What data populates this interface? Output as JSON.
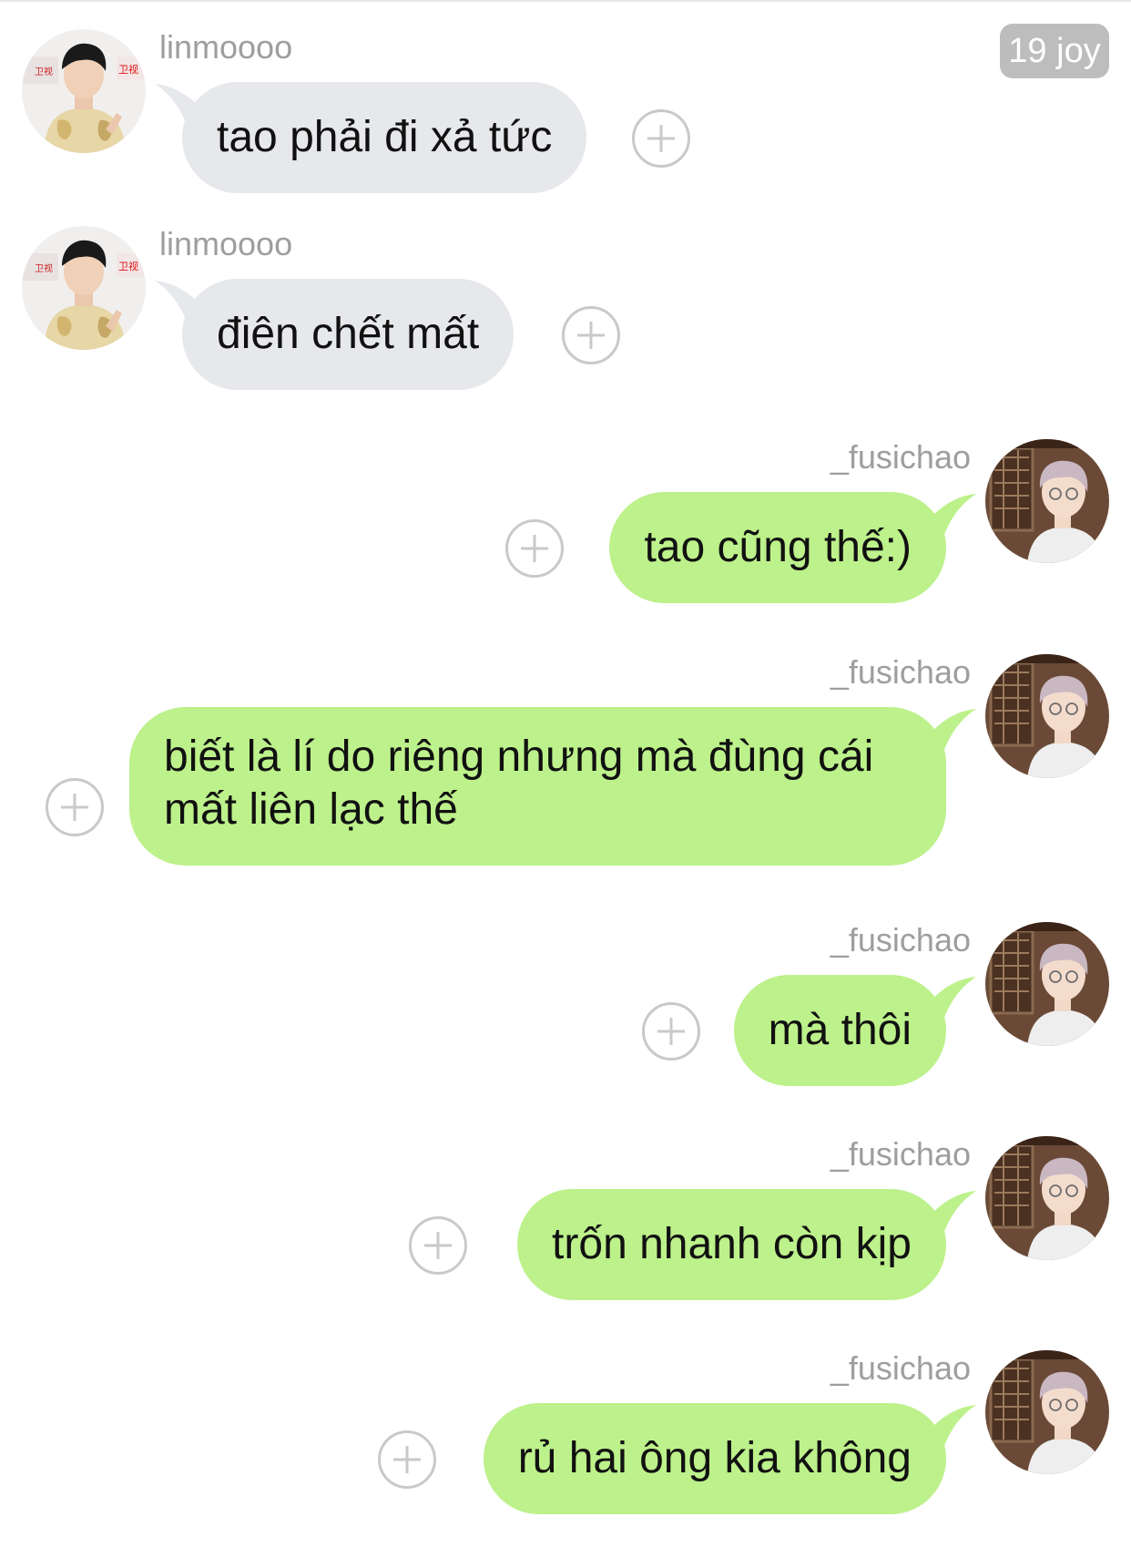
{
  "header": {
    "badge": "19 joy"
  },
  "messages": [
    {
      "side": "left",
      "sender": "linmoooo",
      "text": "tao phải đi xả tức",
      "avatar": "avatar-linmoooo"
    },
    {
      "side": "left",
      "sender": "linmoooo",
      "text": "điên chết mất",
      "avatar": "avatar-linmoooo"
    },
    {
      "side": "right",
      "sender": "_fusichao",
      "text": "tao cũng thế:)",
      "avatar": "avatar-fusichao"
    },
    {
      "side": "right",
      "sender": "_fusichao",
      "lines": [
        "biết là lí do riêng nhưng mà đùng cái",
        "mất liên lạc thế"
      ],
      "avatar": "avatar-fusichao"
    },
    {
      "side": "right",
      "sender": "_fusichao",
      "text": "mà thôi",
      "avatar": "avatar-fusichao"
    },
    {
      "side": "right",
      "sender": "_fusichao",
      "text": "trốn nhanh còn kịp",
      "avatar": "avatar-fusichao"
    },
    {
      "side": "right",
      "sender": "_fusichao",
      "text": "rủ hai ông kia không",
      "avatar": "avatar-fusichao"
    }
  ],
  "icons": {
    "add_reaction": "plus-circle-icon"
  },
  "colors": {
    "incoming_bubble": "#e6e8ec",
    "outgoing_bubble": "#bdf18b",
    "name_text": "#9e9e9e",
    "badge_bg": "#bdbdbd",
    "plus_icon": "#c9c9c9"
  }
}
